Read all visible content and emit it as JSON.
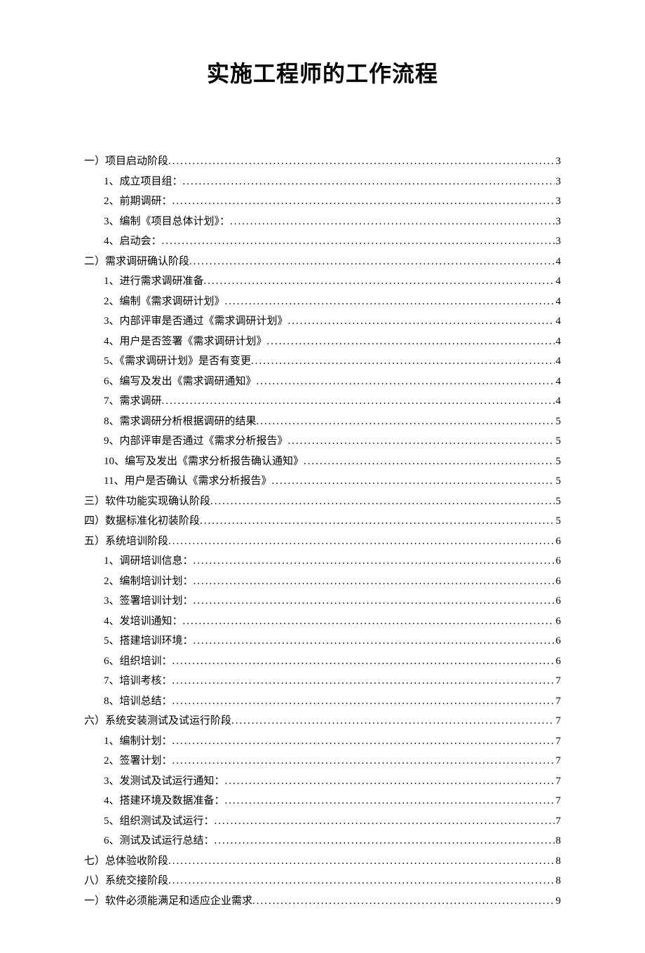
{
  "title": "实施工程师的工作流程",
  "toc": [
    {
      "level": 0,
      "label": "一）项目启动阶段",
      "page": "3"
    },
    {
      "level": 1,
      "label": "1、成立项目组：",
      "page": "3"
    },
    {
      "level": 1,
      "label": "2、前期调研：",
      "page": "3"
    },
    {
      "level": 1,
      "label": "3、编制《项目总体计划》：",
      "page": "3"
    },
    {
      "level": 1,
      "label": "4、启动会：",
      "page": "3"
    },
    {
      "level": 0,
      "label": "二）需求调研确认阶段",
      "page": "4"
    },
    {
      "level": 1,
      "label": "1、进行需求调研准备",
      "page": "4"
    },
    {
      "level": 1,
      "label": "2、编制《需求调研计划》",
      "page": "4"
    },
    {
      "level": 1,
      "label": "3、内部评审是否通过《需求调研计划》",
      "page": "4"
    },
    {
      "level": 1,
      "label": "4、用户是否签署《需求调研计划》",
      "page": "4"
    },
    {
      "level": 1,
      "label": "5、《需求调研计划》是否有变更",
      "page": "4"
    },
    {
      "level": 1,
      "label": "6、编写及发出《需求调研通知》",
      "page": "4"
    },
    {
      "level": 1,
      "label": "7、需求调研",
      "page": "4"
    },
    {
      "level": 1,
      "label": "8、需求调研分析根据调研的结果",
      "page": "5"
    },
    {
      "level": 1,
      "label": "9、内部评审是否通过《需求分析报告》",
      "page": "5"
    },
    {
      "level": 1,
      "label": "10、编写及发出《需求分析报告确认通知》",
      "page": "5"
    },
    {
      "level": 1,
      "label": "11、用户是否确认《需求分析报告》",
      "page": "5"
    },
    {
      "level": 0,
      "label": "三）软件功能实现确认阶段",
      "page": "5"
    },
    {
      "level": 0,
      "label": "四）数据标准化初装阶段",
      "page": "5"
    },
    {
      "level": 0,
      "label": "五）系统培训阶段",
      "page": "6"
    },
    {
      "level": 1,
      "label": "1、调研培训信息：",
      "page": "6"
    },
    {
      "level": 1,
      "label": "2、编制培训计划：",
      "page": "6"
    },
    {
      "level": 1,
      "label": "3、签署培训计划：",
      "page": "6"
    },
    {
      "level": 1,
      "label": "4、发培训通知：",
      "page": "6"
    },
    {
      "level": 1,
      "label": "5、搭建培训环境：",
      "page": "6"
    },
    {
      "level": 1,
      "label": "6、组织培训：",
      "page": "6"
    },
    {
      "level": 1,
      "label": "7、培训考核：",
      "page": "7"
    },
    {
      "level": 1,
      "label": "8、培训总结：",
      "page": "7"
    },
    {
      "level": 0,
      "label": "六）系统安装测试及试运行阶段",
      "page": "7"
    },
    {
      "level": 1,
      "label": "1、编制计划：",
      "page": "7"
    },
    {
      "level": 1,
      "label": "2、签署计划：",
      "page": "7"
    },
    {
      "level": 1,
      "label": "3、发测试及试运行通知：",
      "page": "7"
    },
    {
      "level": 1,
      "label": "4、搭建环境及数据准备：",
      "page": "7"
    },
    {
      "level": 1,
      "label": "5、组织测试及试运行：",
      "page": "7"
    },
    {
      "level": 1,
      "label": "6、测试及试运行总结：",
      "page": "8"
    },
    {
      "level": 0,
      "label": "七）总体验收阶段",
      "page": "8"
    },
    {
      "level": 0,
      "label": "八）系统交接阶段",
      "page": "8"
    },
    {
      "level": 0,
      "label": "一）软件必须能满足和适应企业需求",
      "page": "9"
    }
  ]
}
